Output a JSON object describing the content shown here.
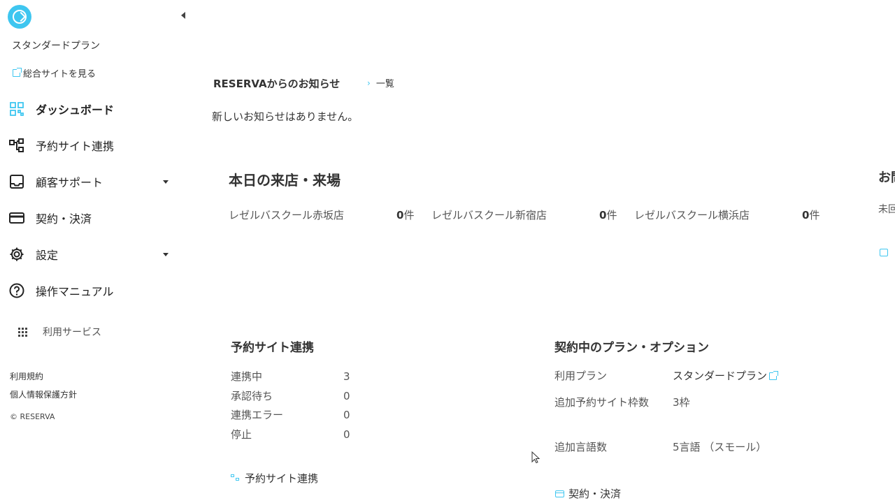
{
  "sidebar": {
    "plan_name": "スタンダードプラン",
    "site_link": "総合サイトを見る",
    "nav": [
      {
        "label": "ダッシュボード",
        "icon": "dashboard-icon",
        "active": true
      },
      {
        "label": "予約サイト連携",
        "icon": "sitemap-icon"
      },
      {
        "label": "顧客サポート",
        "icon": "inbox-icon",
        "expandable": true
      },
      {
        "label": "契約・決済",
        "icon": "credit-card-icon"
      },
      {
        "label": "設定",
        "icon": "gear-icon",
        "expandable": true
      },
      {
        "label": "操作マニュアル",
        "icon": "help-circle-icon"
      }
    ],
    "services_label": "利用サービス",
    "footer": {
      "terms": "利用規約",
      "privacy": "個人情報保護方針",
      "copyright": "© RESERVA"
    }
  },
  "news": {
    "title": "RESERVAからのお知らせ",
    "list_link": "一覧",
    "empty_message": "新しいお知らせはありません。"
  },
  "today": {
    "title": "本日の来店・来場",
    "stores": [
      {
        "name": "レゼルバスクール赤坂店",
        "count": "0",
        "unit": "件"
      },
      {
        "name": "レゼルバスクール新宿店",
        "count": "0",
        "unit": "件"
      },
      {
        "name": "レゼルバスクール横浜店",
        "count": "0",
        "unit": "件"
      }
    ]
  },
  "right_panel": {
    "title_fragment": "お問",
    "text_fragment": "未回"
  },
  "site_link_card": {
    "title": "予約サイト連携",
    "rows": [
      {
        "label": "連携中",
        "value": "3"
      },
      {
        "label": "承認待ち",
        "value": "0"
      },
      {
        "label": "連携エラー",
        "value": "0"
      },
      {
        "label": "停止",
        "value": "0"
      }
    ],
    "link": "予約サイト連携"
  },
  "contract_card": {
    "title": "契約中のプラン・オプション",
    "rows": [
      {
        "label": "利用プラン",
        "value": "スタンダードプラン"
      },
      {
        "label": "追加予約サイト枠数",
        "value": "3枠"
      },
      {
        "label": "追加言語数",
        "value": "5言語 （スモール）"
      }
    ],
    "link": "契約・決済"
  },
  "colors": {
    "accent": "#3ec6f0",
    "text": "#333333",
    "muted": "#555555"
  }
}
